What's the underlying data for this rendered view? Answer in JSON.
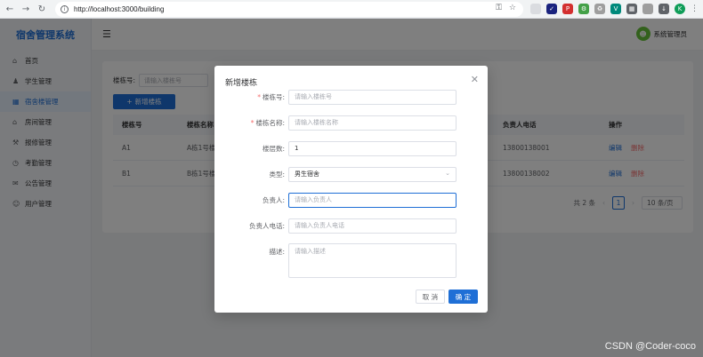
{
  "browser": {
    "url": "http://localhost:3000/building",
    "back_icon": "arrow-left",
    "forward_icon": "arrow-right",
    "reload_icon": "reload",
    "profile_initial": "K"
  },
  "app": {
    "title": "宿舍管理系统",
    "user": "系统管理员",
    "menu": [
      {
        "label": "首页",
        "icon": "home"
      },
      {
        "label": "学生管理",
        "icon": "user"
      },
      {
        "label": "宿舍楼管理",
        "icon": "building",
        "active": true
      },
      {
        "label": "房间管理",
        "icon": "room"
      },
      {
        "label": "报修管理",
        "icon": "wrench"
      },
      {
        "label": "考勤管理",
        "icon": "clock"
      },
      {
        "label": "公告管理",
        "icon": "bell"
      },
      {
        "label": "用户管理",
        "icon": "users"
      }
    ]
  },
  "page": {
    "search_label": "楼栋号:",
    "search_placeholder": "请输入楼栋号",
    "add_button": "新增楼栋",
    "columns": [
      "楼栋号",
      "楼栋名称",
      "负责人电话",
      "操作"
    ],
    "rows": [
      {
        "code": "A1",
        "name": "A栋1号楼",
        "phone": "13800138001",
        "edit": "编辑",
        "delete": "删除"
      },
      {
        "code": "B1",
        "name": "B栋1号楼",
        "phone": "13800138002",
        "edit": "编辑",
        "delete": "删除"
      }
    ],
    "pager": {
      "total": "共 2 条",
      "current": "1",
      "page_size": "10 条/页"
    }
  },
  "dialog": {
    "title": "新增楼栋",
    "fields": {
      "code_label": "楼栋号:",
      "code_placeholder": "请输入楼栋号",
      "name_label": "楼栋名称:",
      "name_placeholder": "请输入楼栋名称",
      "floors_label": "楼层数:",
      "floors_value": "1",
      "type_label": "类型:",
      "type_value": "男生宿舍",
      "manager_label": "负责人:",
      "manager_placeholder": "请输入负责人",
      "phone_label": "负责人电话:",
      "phone_placeholder": "请输入负责人电话",
      "desc_label": "描述:",
      "desc_placeholder": "请输入描述"
    },
    "cancel": "取 消",
    "confirm": "确 定"
  },
  "watermark": "CSDN @Coder-coco",
  "colors": {
    "primary": "#1f6fd6",
    "danger": "#f56c6c"
  }
}
